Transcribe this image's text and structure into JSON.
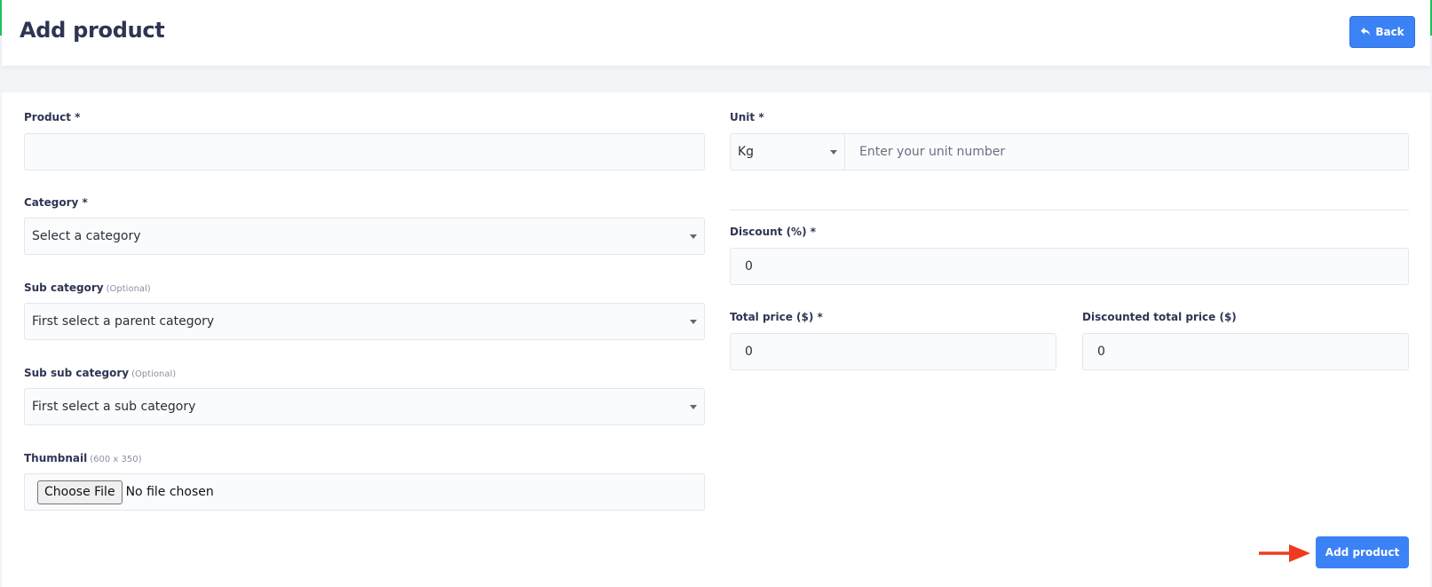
{
  "header": {
    "title": "Add product",
    "back_label": "Back"
  },
  "form": {
    "product": {
      "label": "Product *",
      "value": ""
    },
    "category": {
      "label": "Category *",
      "selected": "Select a category"
    },
    "sub_category": {
      "label": "Sub category",
      "hint": "(Optional)",
      "selected": "First select a parent category"
    },
    "sub_sub_category": {
      "label": "Sub sub category",
      "hint": "(Optional)",
      "selected": "First select a sub category"
    },
    "thumbnail": {
      "label": "Thumbnail",
      "hint": "(600 x 350)",
      "button_label": "Choose File",
      "status": "No file chosen"
    },
    "unit": {
      "label": "Unit *",
      "unit_selected": "Kg",
      "placeholder": "Enter your unit number"
    },
    "discount": {
      "label": "Discount (%) *",
      "value": "0"
    },
    "total_price": {
      "label": "Total price ($) *",
      "value": "0"
    },
    "discounted_total_price": {
      "label": "Discounted total price ($)",
      "value": "0"
    },
    "submit_label": "Add product"
  },
  "icons": {
    "back": "reply-arrow-icon",
    "annotation": "red-arrow-icon"
  },
  "colors": {
    "primary": "#3b82f6",
    "title": "#2e3553",
    "annotation_arrow": "#ee3b1f",
    "accent_edge": "#22c55e"
  }
}
